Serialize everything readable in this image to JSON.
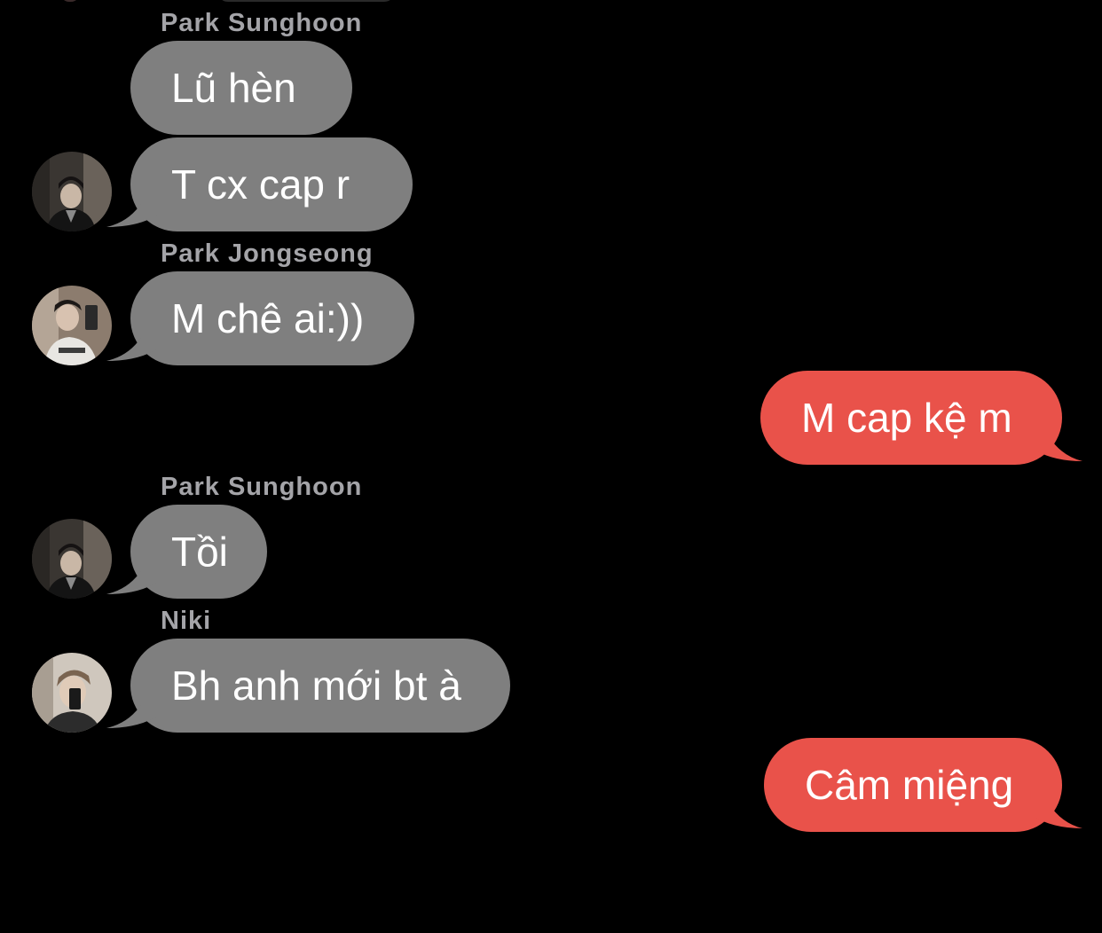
{
  "colors": {
    "background": "#000000",
    "incoming_bubble": "#7f7f7f",
    "outgoing_bubble": "#e9524a",
    "sender_name": "#a4a4a8",
    "bubble_text": "#ffffff"
  },
  "messages": [
    {
      "direction": "incoming",
      "sender": "Park Sunghoon",
      "text": "Lũ hèn"
    },
    {
      "direction": "incoming",
      "text": "T cx cap r",
      "avatar": "avatar-park-sunghoon"
    },
    {
      "direction": "incoming",
      "sender": "Park Jongseong",
      "text": "M chê ai:))",
      "avatar": "avatar-park-jongseong"
    },
    {
      "direction": "outgoing",
      "text": "M cap kệ m"
    },
    {
      "direction": "incoming",
      "sender": "Park Sunghoon",
      "text": "Tồi",
      "avatar": "avatar-park-sunghoon"
    },
    {
      "direction": "incoming",
      "sender": "Niki",
      "text": "Bh anh mới bt à",
      "avatar": "avatar-niki"
    },
    {
      "direction": "outgoing",
      "text": "Câm miệng"
    }
  ]
}
